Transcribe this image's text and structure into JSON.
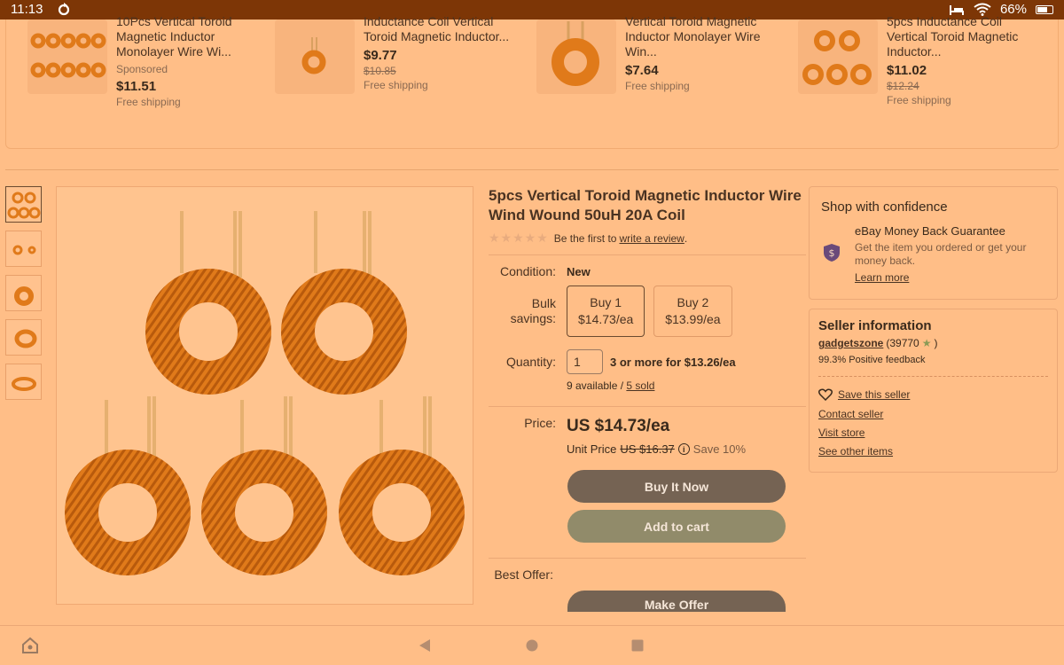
{
  "status_bar": {
    "time": "11:13",
    "battery": "66%"
  },
  "carousel": [
    {
      "title": "10Pcs Vertical Toroid Magnetic Inductor Monolayer Wire Wi...",
      "sponsored": "Sponsored",
      "price": "$11.51",
      "was": "",
      "shipping": "Free shipping"
    },
    {
      "title": "Inductance Coil Vertical Toroid Magnetic Inductor...",
      "sponsored": "",
      "price": "$9.77",
      "was": "$10.85",
      "shipping": "Free shipping"
    },
    {
      "title": "Vertical Toroid Magnetic Inductor Monolayer Wire Win...",
      "sponsored": "",
      "price": "$7.64",
      "was": "",
      "shipping": "Free shipping"
    },
    {
      "title": "5pcs Inductance Coil Vertical Toroid Magnetic Inductor...",
      "sponsored": "",
      "price": "$11.02",
      "was": "$12.24",
      "shipping": "Free shipping"
    }
  ],
  "product": {
    "title": "5pcs Vertical Toroid Magnetic Inductor Wire Wind Wound 50uH 20A Coil",
    "rating_text": "Be the first to",
    "review_link": "write a review",
    "review_suffix": ".",
    "condition_label": "Condition:",
    "condition": "New",
    "bulk_label": "Bulk savings:",
    "bulk_options": [
      {
        "qty": "Buy 1",
        "price": "$14.73/ea"
      },
      {
        "qty": "Buy 2",
        "price": "$13.99/ea"
      }
    ],
    "quantity_label": "Quantity:",
    "quantity_value": "1",
    "quantity_deal": "3 or more for $13.26/ea",
    "available": "9 available /",
    "sold": "5 sold",
    "price_label": "Price:",
    "price": "US $14.73/ea",
    "unit_price_label": "Unit Price",
    "unit_price_was": "US $16.37",
    "save": "Save 10%",
    "buy_now": "Buy It Now",
    "add_to_cart": "Add to cart",
    "best_offer_label": "Best Offer:",
    "make_offer": "Make Offer"
  },
  "confidence": {
    "heading": "Shop with confidence",
    "guarantee_title": "eBay Money Back Guarantee",
    "guarantee_text": "Get the item you ordered or get your money back.",
    "learn_more": "Learn more"
  },
  "seller": {
    "heading": "Seller information",
    "name": "gadgetszone",
    "score": "(39770",
    "score_close": ")",
    "feedback": "99.3% Positive feedback",
    "save_seller": "Save this seller",
    "contact": "Contact seller",
    "visit_store": "Visit store",
    "other_items": "See other items"
  },
  "icons": {
    "sync": "sync-icon",
    "bed": "bed-icon",
    "wifi": "wifi-icon",
    "battery": "battery-icon",
    "shield": "shield-dollar-icon",
    "heart": "heart-icon",
    "star": "star-icon",
    "info": "info-icon",
    "back": "back-icon",
    "home": "home-icon",
    "recents": "recents-icon",
    "assistant": "assistant-icon"
  },
  "colors": {
    "overlay": "#ffbe87",
    "status_bar": "#7d3606",
    "buy_now": "#756353",
    "add_to_cart": "#918b6a",
    "coil": "#e07a1a"
  }
}
